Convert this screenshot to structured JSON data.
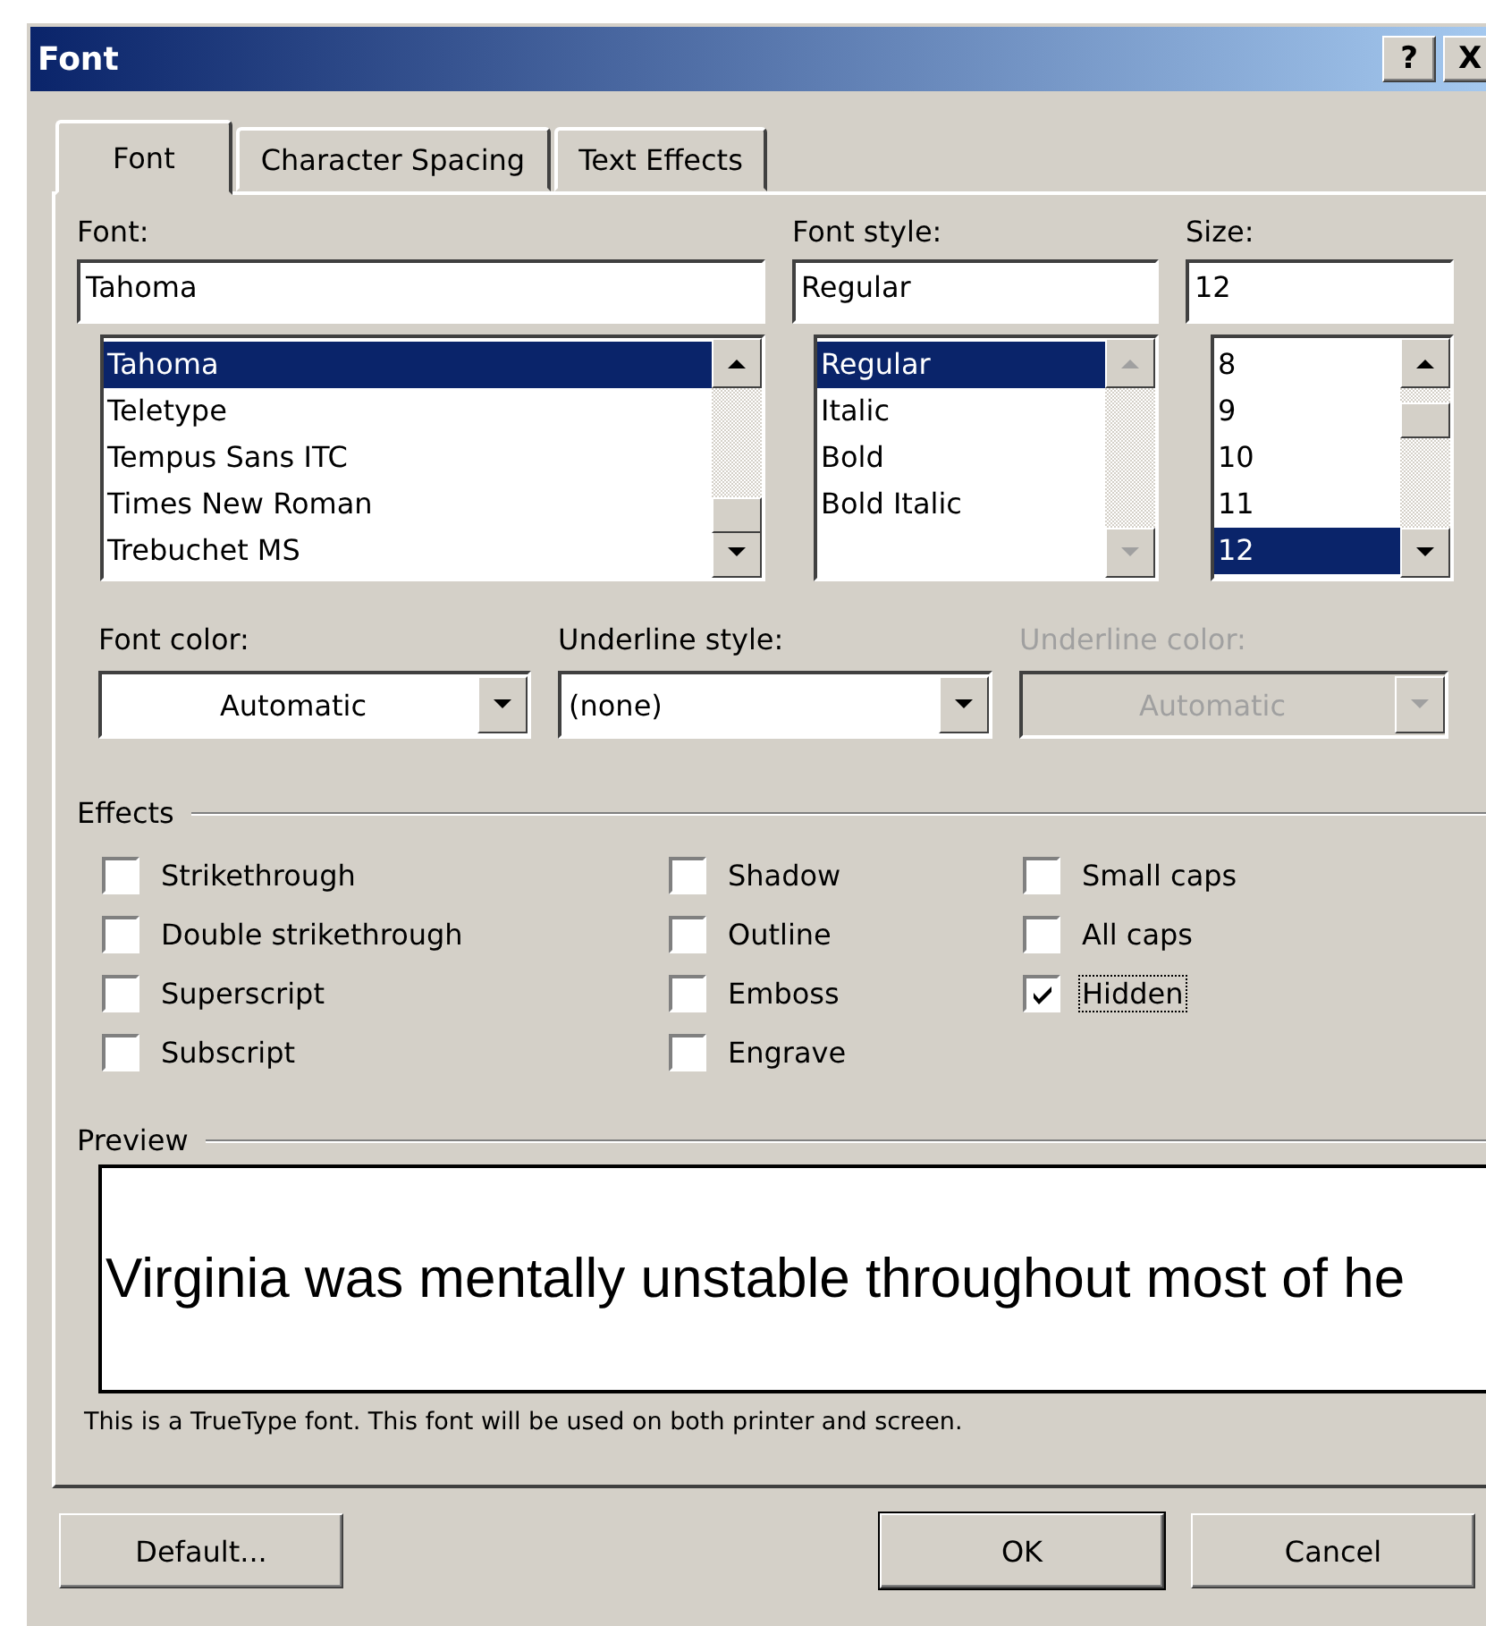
{
  "window": {
    "title": "Font",
    "help_button": "?",
    "close_button": "X"
  },
  "tabs": [
    {
      "label": "Font",
      "selected": true
    },
    {
      "label": "Character Spacing",
      "selected": false
    },
    {
      "label": "Text Effects",
      "selected": false
    }
  ],
  "lists": [
    {
      "label": "Font:",
      "value": "Tahoma",
      "scrollbar_disabled": false,
      "items": [
        {
          "label": "Tahoma",
          "selected": true
        },
        {
          "label": "Teletype",
          "selected": false
        },
        {
          "label": "Tempus Sans ITC",
          "selected": false
        },
        {
          "label": "Times New Roman",
          "selected": false
        },
        {
          "label": "Trebuchet MS",
          "selected": false
        }
      ]
    },
    {
      "label": "Font style:",
      "value": "Regular",
      "scrollbar_disabled": true,
      "items": [
        {
          "label": "Regular",
          "selected": true
        },
        {
          "label": "Italic",
          "selected": false
        },
        {
          "label": "Bold",
          "selected": false
        },
        {
          "label": "Bold Italic",
          "selected": false
        }
      ]
    },
    {
      "label": "Size:",
      "value": "12",
      "scrollbar_disabled": false,
      "items": [
        {
          "label": "8",
          "selected": false
        },
        {
          "label": "9",
          "selected": false
        },
        {
          "label": "10",
          "selected": false
        },
        {
          "label": "11",
          "selected": false
        },
        {
          "label": "12",
          "selected": true
        }
      ]
    }
  ],
  "dropdowns": [
    {
      "label": "Font color:",
      "value": "Automatic",
      "kind": "color",
      "disabled": false
    },
    {
      "label": "Underline style:",
      "value": "(none)",
      "kind": "list",
      "disabled": false
    },
    {
      "label": "Underline color:",
      "value": "Automatic",
      "kind": "color",
      "disabled": true
    }
  ],
  "effects": {
    "label": "Effects",
    "columns": [
      [
        {
          "label": "Strikethrough",
          "checked": false,
          "focused": false
        },
        {
          "label": "Double strikethrough",
          "checked": false,
          "focused": false
        },
        {
          "label": "Superscript",
          "checked": false,
          "focused": false
        },
        {
          "label": "Subscript",
          "checked": false,
          "focused": false
        }
      ],
      [
        {
          "label": "Shadow",
          "checked": false,
          "focused": false
        },
        {
          "label": "Outline",
          "checked": false,
          "focused": false
        },
        {
          "label": "Emboss",
          "checked": false,
          "focused": false
        },
        {
          "label": "Engrave",
          "checked": false,
          "focused": false
        }
      ],
      [
        {
          "label": "Small caps",
          "checked": false,
          "focused": false
        },
        {
          "label": "All caps",
          "checked": false,
          "focused": false
        },
        {
          "label": "Hidden",
          "checked": true,
          "focused": true
        }
      ]
    ]
  },
  "preview": {
    "label": "Preview",
    "text": "Virginia was mentally unstable throughout most of he",
    "note": "This is a TrueType font. This font will be used on both printer and screen."
  },
  "buttons": [
    {
      "label": "Default...",
      "default": false
    },
    {
      "label": "OK",
      "default": true
    },
    {
      "label": "Cancel",
      "default": false
    }
  ]
}
